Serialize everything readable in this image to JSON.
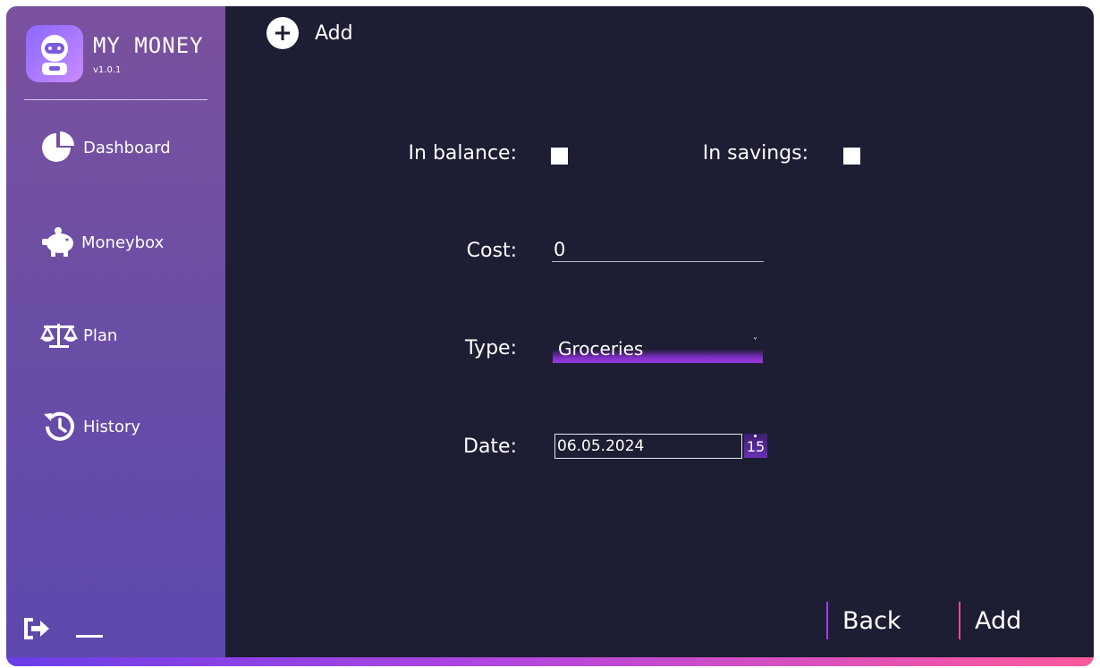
{
  "app": {
    "title": "MY MONEY",
    "version": "v1.0.1"
  },
  "sidebar": {
    "items": [
      {
        "label": "Dashboard",
        "icon": "pie-chart-icon"
      },
      {
        "label": "Moneybox",
        "icon": "piggy-bank-icon"
      },
      {
        "label": "Plan",
        "icon": "scales-icon"
      },
      {
        "label": "History",
        "icon": "history-icon"
      }
    ]
  },
  "header": {
    "add_label": "Add",
    "add_icon": "plus-circle-icon"
  },
  "form": {
    "in_balance_label": "In balance:",
    "in_savings_label": "In savings:",
    "cost_label": "Cost:",
    "cost_value": "0",
    "type_label": "Type:",
    "type_value": "Groceries",
    "date_label": "Date:",
    "date_value": "06.05.2024",
    "calendar_day": "15"
  },
  "footer": {
    "back_label": "Back",
    "add_label": "Add"
  },
  "colors": {
    "background": "#1d1d33",
    "sidebar_top": "#7a519d",
    "sidebar_bottom": "#5d48ad",
    "accent_purple": "#a03df0",
    "accent_pink": "#ea4f8f"
  }
}
